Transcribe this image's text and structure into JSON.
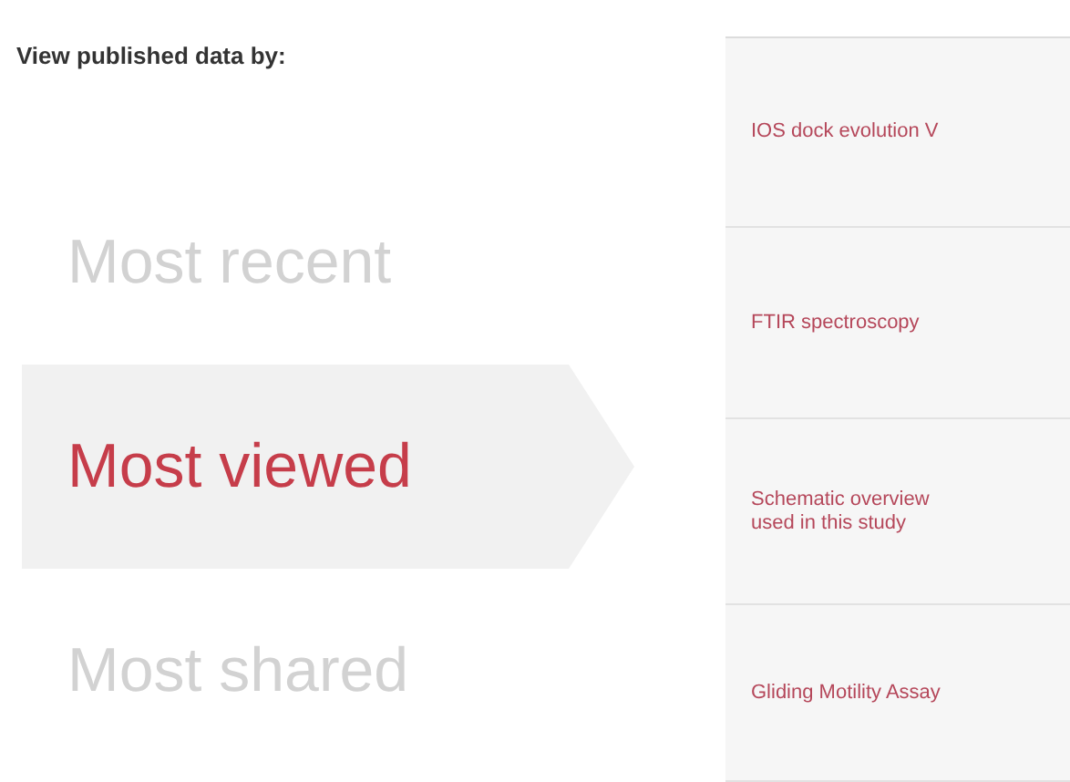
{
  "heading": "View published data by:",
  "tabs": [
    {
      "label": "Most recent",
      "selected": false
    },
    {
      "label": "Most viewed",
      "selected": true
    },
    {
      "label": "Most shared",
      "selected": false
    }
  ],
  "items": [
    {
      "lines": [
        "IOS dock evolution V"
      ]
    },
    {
      "lines": [
        "FTIR spectroscopy"
      ]
    },
    {
      "lines": [
        "Schematic overview",
        "used in this study"
      ]
    },
    {
      "lines": [
        "Gliding Motility Assay"
      ]
    }
  ]
}
